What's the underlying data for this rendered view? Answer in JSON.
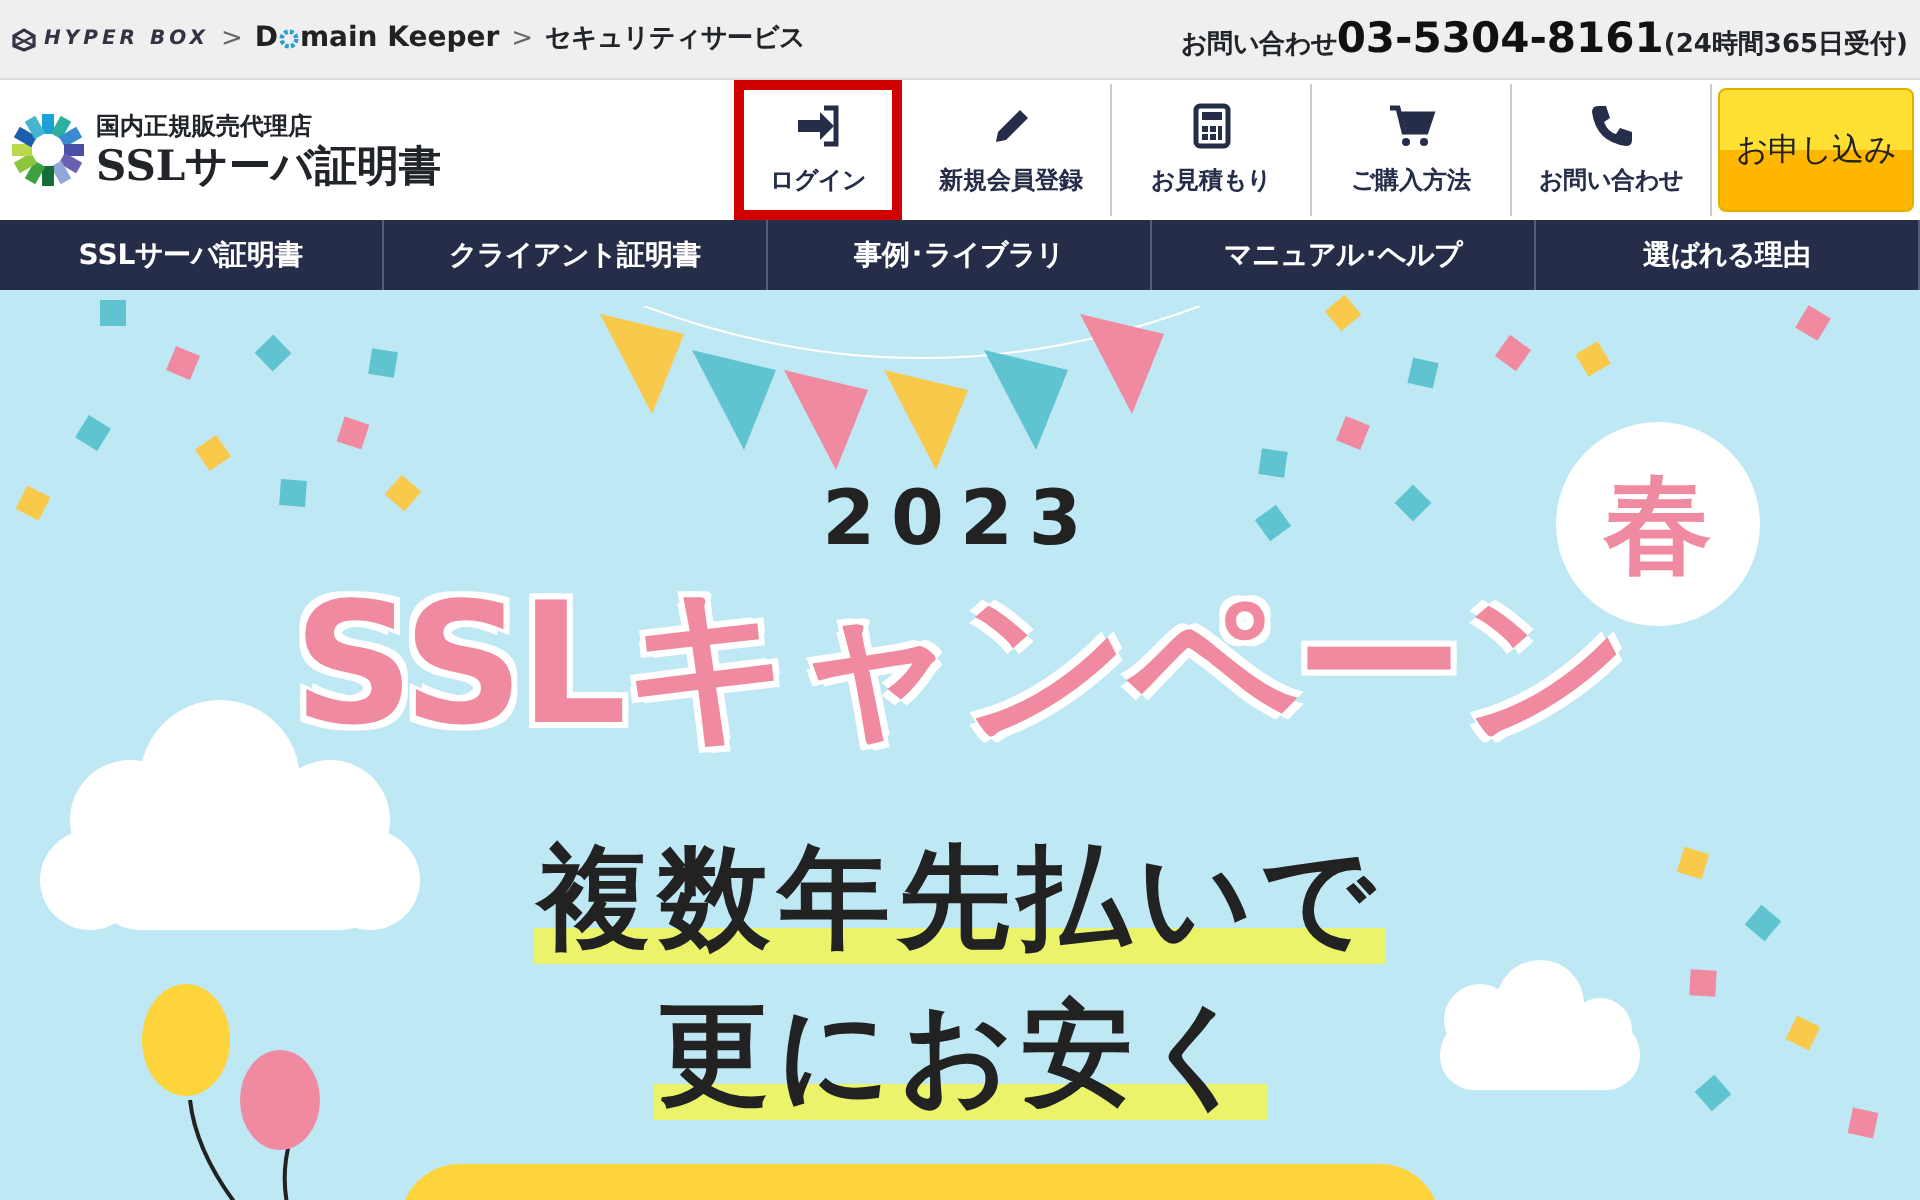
{
  "top_bar": {
    "breadcrumbs": [
      {
        "kind": "hyperbox",
        "label": "HYPER BOX"
      },
      {
        "kind": "separator",
        "label": ">"
      },
      {
        "kind": "domain",
        "label_before": "D",
        "label_after": "main Keeper"
      },
      {
        "kind": "separator",
        "label": ">"
      },
      {
        "kind": "text",
        "label": "セキュリティサービス"
      }
    ],
    "contact": {
      "label": "お問い合わせ",
      "phone": "03-5304-8161",
      "hours": "(24時間365日受付)"
    }
  },
  "logo": {
    "tagline": "国内正規販売代理店",
    "name": "SSLサーバ証明書"
  },
  "header_links": [
    {
      "kind": "login",
      "label": "ログイン",
      "highlighted": true
    },
    {
      "kind": "pencil",
      "label": "新規会員登録",
      "highlighted": false
    },
    {
      "kind": "calculator",
      "label": "お見積もり",
      "highlighted": false
    },
    {
      "kind": "cart",
      "label": "ご購入方法",
      "highlighted": false
    },
    {
      "kind": "phone",
      "label": "お問い合わせ",
      "highlighted": false
    }
  ],
  "apply_button": "お申し込み",
  "nav": [
    "SSLサーバ証明書",
    "クライアント証明書",
    "事例･ライブラリ",
    "マニュアル･ヘルプ",
    "選ばれる理由"
  ],
  "hero": {
    "year": "2023",
    "title": "SSLキャンペーン",
    "season": "春",
    "lines": [
      "複数年先払いで",
      "更にお安く"
    ]
  }
}
